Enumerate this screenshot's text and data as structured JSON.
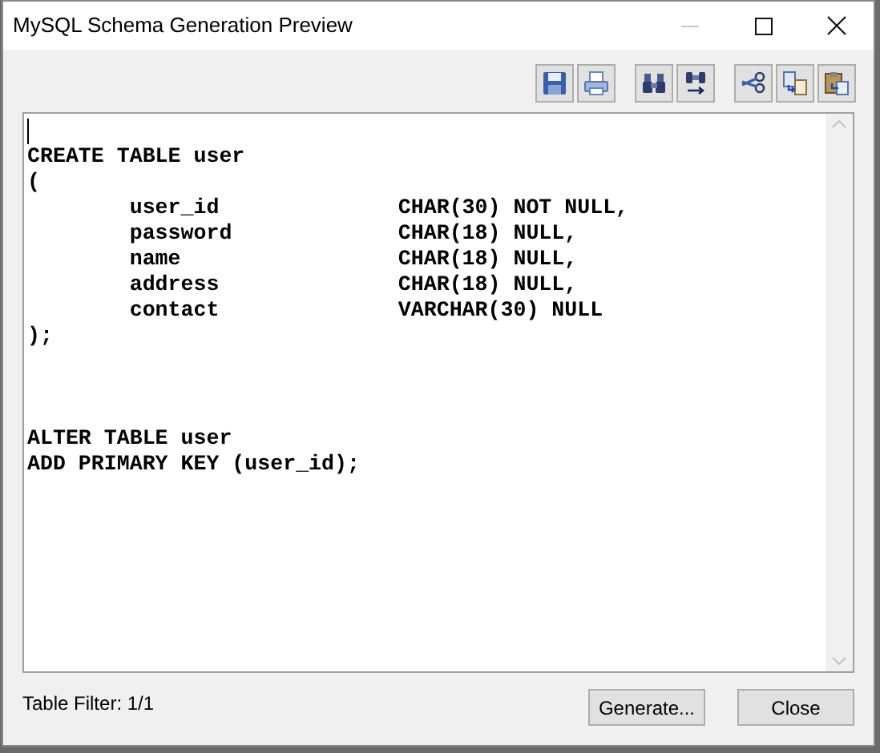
{
  "window": {
    "title": "MySQL Schema Generation Preview",
    "controls": [
      {
        "kind": "minimize",
        "disabled": true
      },
      {
        "kind": "maximize",
        "disabled": false
      },
      {
        "kind": "close",
        "disabled": false
      }
    ]
  },
  "toolbar": [
    {
      "items": [
        {
          "kind": "save"
        },
        {
          "kind": "print"
        }
      ]
    },
    {
      "items": [
        {
          "kind": "find"
        },
        {
          "kind": "replace"
        }
      ]
    },
    {
      "items": [
        {
          "kind": "cut"
        },
        {
          "kind": "copy"
        },
        {
          "kind": "paste"
        }
      ]
    }
  ],
  "editor": {
    "lines": [
      {
        "kind": "blank",
        "caret": true
      },
      {
        "kind": "code",
        "text": "CREATE TABLE user"
      },
      {
        "kind": "code",
        "text": "("
      },
      {
        "kind": "code",
        "text": "        user_id              CHAR(30) NOT NULL,"
      },
      {
        "kind": "code",
        "text": "        password             CHAR(18) NULL,"
      },
      {
        "kind": "code",
        "text": "        name                 CHAR(18) NULL,"
      },
      {
        "kind": "code",
        "text": "        address              CHAR(18) NULL,"
      },
      {
        "kind": "code",
        "text": "        contact              VARCHAR(30) NULL"
      },
      {
        "kind": "code",
        "text": ");"
      },
      {
        "kind": "blank",
        "caret": false
      },
      {
        "kind": "blank",
        "caret": false
      },
      {
        "kind": "blank",
        "caret": false
      },
      {
        "kind": "code",
        "text": "ALTER TABLE user"
      },
      {
        "kind": "code",
        "text": "ADD PRIMARY KEY (user_id);"
      }
    ]
  },
  "status": {
    "table_filter": "Table Filter: 1/1"
  },
  "buttons": [
    "Generate...",
    "Close"
  ]
}
